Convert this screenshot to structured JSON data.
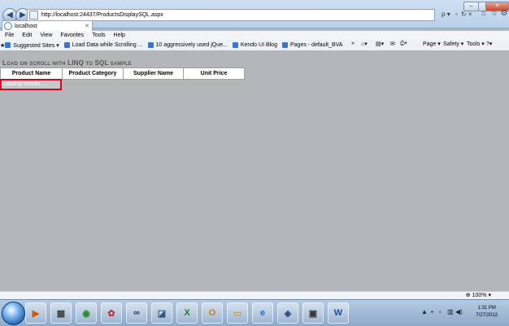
{
  "browser": {
    "url": "http://localhost:24437/ProductsDisplaySQL.aspx",
    "tab_label": "localhost"
  },
  "menu": [
    "File",
    "Edit",
    "View",
    "Favorites",
    "Tools",
    "Help"
  ],
  "favorites": [
    {
      "label": "Suggested Sites ▾",
      "icon": "star-icon"
    },
    {
      "label": "Load Data while Scrolling ...",
      "icon": "page-icon"
    },
    {
      "label": "10 aggressively used jQue...",
      "icon": "page-icon"
    },
    {
      "label": "Kendo UI Blog",
      "icon": "page-icon"
    },
    {
      "label": "Pages - default_BVA",
      "icon": "page-icon"
    }
  ],
  "command_bar": {
    "page": "Page ▾",
    "safety": "Safety ▾",
    "tools": "Tools ▾"
  },
  "page": {
    "title": "Load on scroll with LINQ to SQL sample",
    "columns": [
      "Product Name",
      "Product Category",
      "Supplier Name",
      "Unit Price"
    ],
    "loading_text": "Loading results...."
  },
  "status_bar": {
    "zoom": "100% ▾"
  },
  "taskbar": {
    "time": "1:31 PM",
    "date": "7/27/2012"
  },
  "colors": {
    "highlight": "#e0001b",
    "background": "#b5b6b9"
  }
}
